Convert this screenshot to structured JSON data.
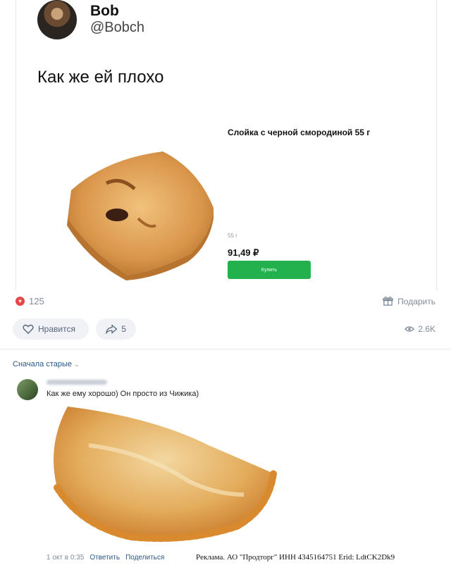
{
  "tweet": {
    "author_name": "Bob",
    "author_handle": "@Bobch",
    "text": "Как же ей плохо",
    "product": {
      "title": "Слойка с черной смородиной 55 г",
      "weight": "55 г",
      "price": "91,49 ₽",
      "buy_label": "Купить"
    }
  },
  "post_stats": {
    "reactions_count": "125",
    "gift_label": "Подарить",
    "like_label": "Нравится",
    "share_count": "5",
    "views": "2.6K"
  },
  "comments": {
    "sort_label": "Сначала старые",
    "items": [
      {
        "text": "Как же ему хорошо) Он просто из Чижика)",
        "date": "1 окт в 0:35",
        "reply_label": "Ответить",
        "share_label": "Поделиться"
      }
    ]
  },
  "ad": {
    "text": "Реклама. АО \"Продторг\" ИНН 4345164751 Erid: LdtCK2Dk9"
  },
  "colors": {
    "link": "#2a5885",
    "buy_button": "#22b14c",
    "heart": "#e64646",
    "muted": "#818c99"
  }
}
